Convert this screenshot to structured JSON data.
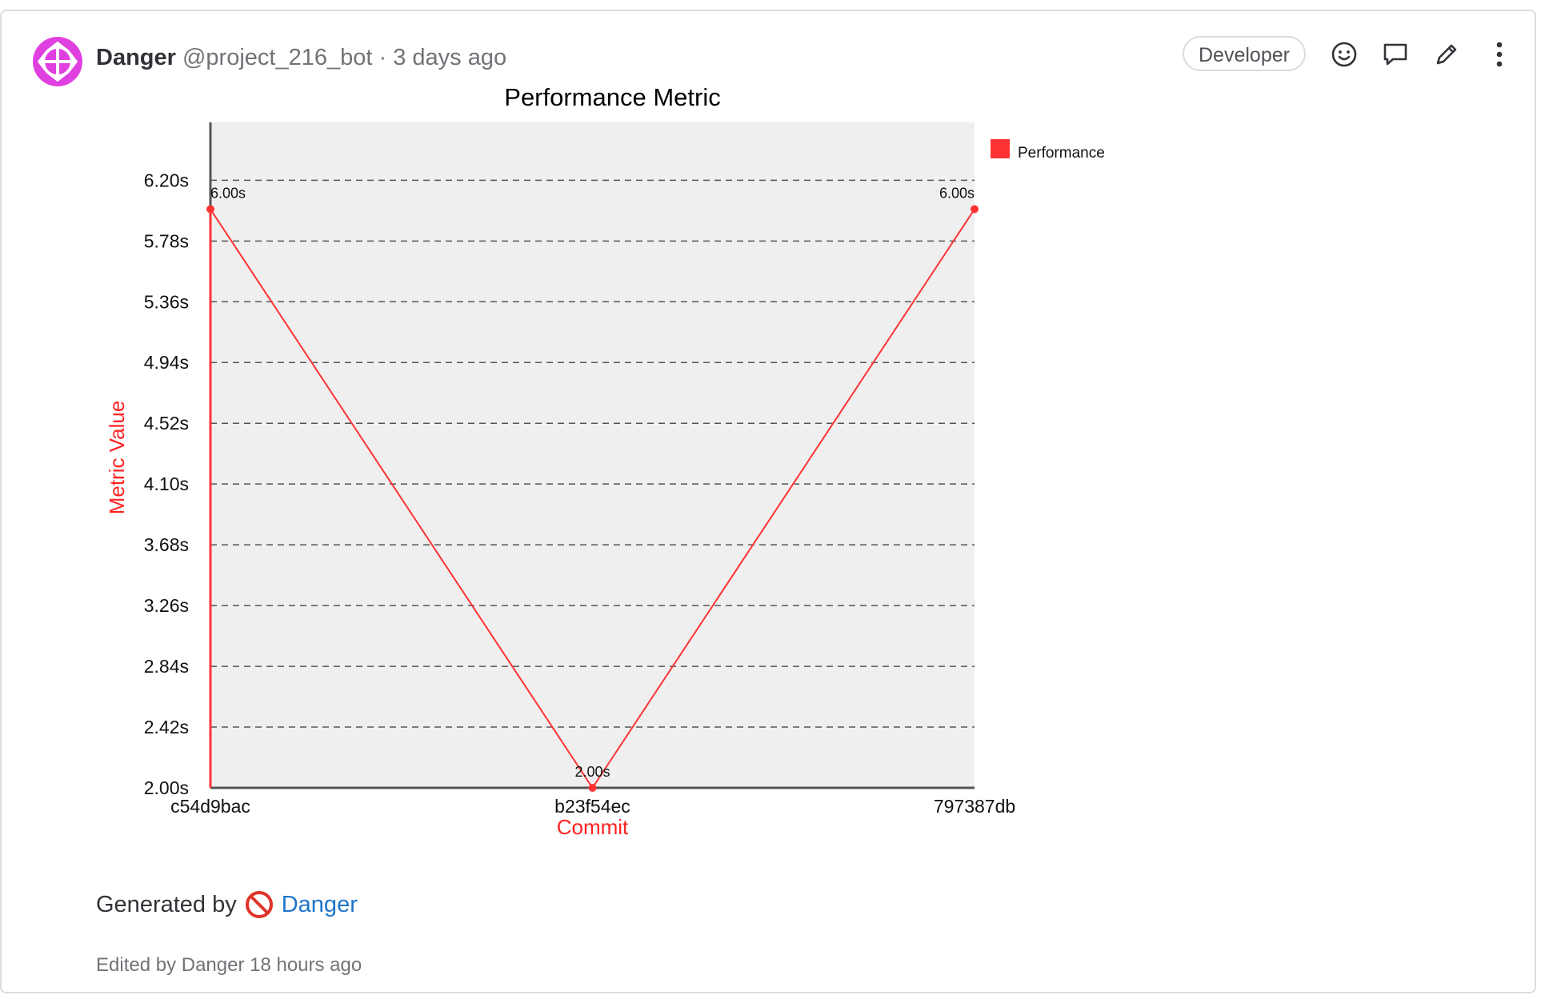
{
  "note": {
    "author": "Danger",
    "username": "@project_216_bot",
    "separator": "·",
    "time": "3 days ago",
    "role_badge": "Developer",
    "generated_prefix": "Generated by",
    "generated_link": "Danger",
    "edited": "Edited by Danger 18 hours ago",
    "icons": {
      "avatar": "danger-bot-avatar-icon",
      "emoji": "smiley-icon",
      "reply": "comment-icon",
      "edit": "pencil-icon",
      "more": "kebab-menu-icon",
      "no_entry": "no-entry-icon"
    }
  },
  "colors": {
    "series": "#ff3333",
    "axis_title": "#ff2222",
    "plot_bg": "#efefef",
    "link": "#1f75cb",
    "avatar": "#e040e0"
  },
  "chart_data": {
    "type": "line",
    "title": "Performance Metric",
    "xlabel": "Commit",
    "ylabel": "Metric Value",
    "categories": [
      "c54d9bac",
      "b23f54ec",
      "797387db"
    ],
    "series": [
      {
        "name": "Performance",
        "values": [
          6.0,
          2.0,
          6.0
        ],
        "labels": [
          "6.00s",
          "2.00s",
          "6.00s"
        ]
      }
    ],
    "yticks": [
      "2.00s",
      "2.42s",
      "2.84s",
      "3.26s",
      "3.68s",
      "4.10s",
      "4.52s",
      "4.94s",
      "5.36s",
      "5.78s",
      "6.20s"
    ],
    "ytick_values": [
      2.0,
      2.42,
      2.84,
      3.26,
      3.68,
      4.1,
      4.52,
      4.94,
      5.36,
      5.78,
      6.2
    ],
    "ylim": [
      2.0,
      6.6
    ],
    "grid": true,
    "legend": "top-right"
  }
}
